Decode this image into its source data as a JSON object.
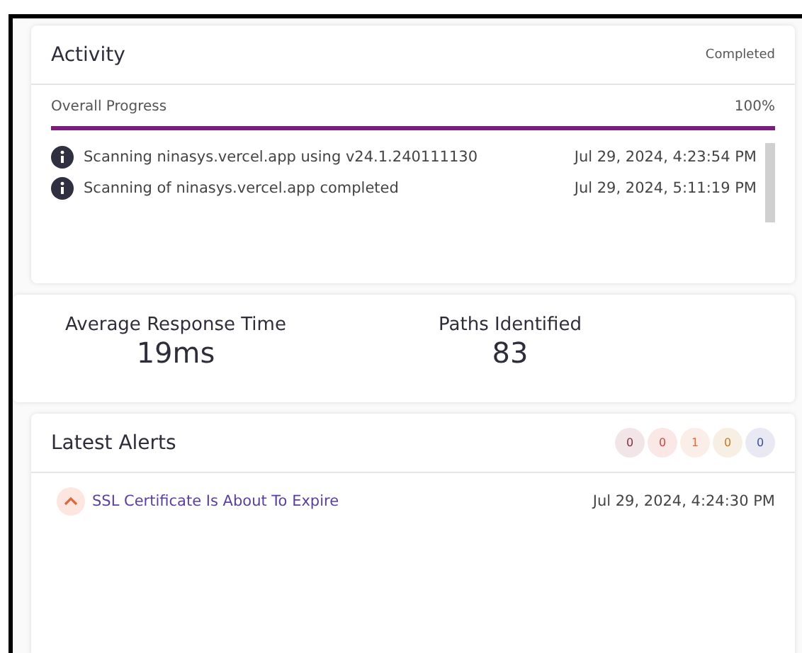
{
  "activity": {
    "title": "Activity",
    "status": "Completed",
    "progress": {
      "label": "Overall Progress",
      "reading": "100%",
      "level": 1
    },
    "events": [
      {
        "message": "Scanning ninasys.vercel.app using v24.1.240111130",
        "time": "Jul 29, 2024, 4:23:54 PM"
      },
      {
        "message": "Scanning of ninasys.vercel.app completed",
        "time": "Jul 29, 2024, 5:11:19 PM"
      }
    ]
  },
  "stats": [
    {
      "label": "Average Response Time",
      "value": "19ms"
    },
    {
      "label": "Paths Identified",
      "value": "83"
    }
  ],
  "alerts": {
    "title": "Latest Alerts",
    "counts": [
      {
        "count": "0",
        "color": "#8b2c3a"
      },
      {
        "count": "0",
        "color": "#d9423c"
      },
      {
        "count": "1",
        "color": "#e0683c"
      },
      {
        "count": "0",
        "color": "#c8781e"
      },
      {
        "count": "0",
        "color": "#3f4aa0"
      }
    ],
    "items": [
      {
        "title": "SSL Certificate Is About To Expire",
        "time": "Jul 29, 2024, 4:24:30 PM"
      }
    ]
  }
}
